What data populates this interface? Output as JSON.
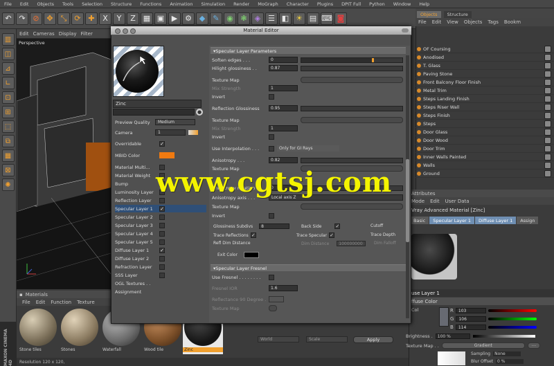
{
  "menubar": {
    "items": [
      "File",
      "Edit",
      "Objects",
      "Tools",
      "Selection",
      "Structure",
      "Functions",
      "Animation",
      "Simulation",
      "Render",
      "MoGraph",
      "Character",
      "Plugins",
      "DPIT Full",
      "Python",
      "Window",
      "Help"
    ]
  },
  "toolbar": {
    "icons": [
      "undo-icon",
      "redo-icon",
      "live-select-icon",
      "move-icon",
      "scale-icon",
      "rotate-icon",
      "recent-icon",
      "x-axis-icon",
      "y-axis-icon",
      "z-axis-icon",
      "world-coordinate-icon",
      "render-region-icon",
      "render-view-icon",
      "render-settings-icon",
      "cube-icon",
      "pen-icon",
      "subdivision-icon",
      "cloner-icon",
      "deformer-icon",
      "scene-icon",
      "camera-icon",
      "light-icon",
      "display-icon",
      "python-icon",
      "layout-icon"
    ]
  },
  "viewport": {
    "menu": [
      "Edit",
      "Cameras",
      "Display",
      "Filter"
    ],
    "label": "Perspective"
  },
  "material_editor": {
    "title": "Material Editor",
    "material_name": "Zinc",
    "channels": [
      {
        "label": "Preview Quality",
        "value": "Medium"
      },
      {
        "label": "Camera",
        "value": "1"
      },
      {
        "label": "Overridable",
        "checked": "✓"
      },
      {
        "label": "MBID Color"
      },
      {
        "label": "Material Multi...",
        "checked": ""
      },
      {
        "label": "Material Weight",
        "checked": ""
      },
      {
        "label": "Bump",
        "checked": ""
      },
      {
        "label": "Luminosity Layer",
        "checked": ""
      },
      {
        "label": "Reflection Layer",
        "checked": ""
      },
      {
        "label": "Specular Layer 1",
        "checked": "✓"
      },
      {
        "label": "Specular Layer 2",
        "checked": ""
      },
      {
        "label": "Specular Layer 3",
        "checked": ""
      },
      {
        "label": "Specular Layer 4",
        "checked": ""
      },
      {
        "label": "Specular Layer 5",
        "checked": ""
      },
      {
        "label": "Diffuse Layer 1",
        "checked": "✓"
      },
      {
        "label": "Diffuse Layer 2",
        "checked": ""
      },
      {
        "label": "Refraction Layer",
        "checked": ""
      },
      {
        "label": "SSS Layer",
        "checked": ""
      },
      {
        "label": "OGL Textures . ."
      },
      {
        "label": "Assignment"
      }
    ],
    "section_params": "Specular Layer Parameters",
    "params": [
      {
        "label": "Soften edges . . .",
        "value": "0"
      },
      {
        "label": "Hilight glossiness . .",
        "value": "0.87"
      },
      {
        "label": "Texture Map"
      },
      {
        "label": "Mix Strength",
        "value": "1"
      },
      {
        "label": "Invert"
      },
      {
        "label": "Reflection Glossiness",
        "value": "0.95"
      },
      {
        "label": "Texture Map"
      },
      {
        "label": "Mix Strength",
        "value": "1"
      },
      {
        "label": "Invert"
      },
      {
        "label": "Use Interpolation . . .",
        "value": "Only for GI Rays"
      },
      {
        "label": "Anisotropy . . .",
        "value": "0.82"
      },
      {
        "label": "Texture Map"
      },
      {
        "label": "Anisotropy rotation",
        "value": "0"
      },
      {
        "label": "Anisotropy axis . . .",
        "value": "Local axis Z"
      },
      {
        "label": "Texture Map"
      },
      {
        "label": "Invert"
      }
    ],
    "options": {
      "glossiness_subdivs": "Glossiness Subdivs",
      "glossiness_subdivs_value": "8",
      "back_side": "Back Side",
      "cutoff": "Cutoff",
      "trace_reflections": "Trace Reflections",
      "trace_specular": "Trace Specular",
      "trace_depth": "Trace Depth",
      "refl_dim_distance": "Refl Dim Distance",
      "dim_distance": "Dim Distance",
      "dim_distance_value": "100000000",
      "dim_falloff": "Dim Falloff",
      "exit_color": "Exit Color"
    },
    "section_fresnel": "Specular Layer Fresnel",
    "fresnel": [
      {
        "label": "Use Fresnel . . . . . . . ."
      },
      {
        "label": "Fresnel IOR",
        "value": "1.6"
      },
      {
        "label": "Reflectance 90 Degree ."
      },
      {
        "label": "Texture Map"
      }
    ],
    "bottom": {
      "world": "World",
      "scale": "Scale",
      "apply": "Apply"
    }
  },
  "watermark": "www.cgtsj.com",
  "materials": {
    "title": "Materials",
    "menu": [
      "File",
      "Edit",
      "Function",
      "Texture"
    ],
    "items": [
      {
        "name": "Stone tiles"
      },
      {
        "name": "Stones"
      },
      {
        "name": "Waterfall"
      },
      {
        "name": "Wood tile"
      },
      {
        "name": "Zinc"
      }
    ],
    "resolution": "Resolution 120 x 120,"
  },
  "objects": {
    "tabs": [
      "Objects",
      "Structure"
    ],
    "menu": [
      "File",
      "Edit",
      "View",
      "Objects",
      "Tags",
      "Bookm"
    ],
    "items": [
      "OF Coursing",
      "Anodised",
      "T. Glass",
      "Paving Stone",
      "Front Balcony Floor Finish",
      "Metal Trim",
      "Steps Landing Finish",
      "Steps Riser Wall",
      "Steps Finish",
      "Steps",
      "Door Glass",
      "Door Wood",
      "Door Trim",
      "Inner Walls Painted",
      "Walls",
      "Ground"
    ]
  },
  "attributes": {
    "title": "Attributes",
    "menu": [
      "Mode",
      "Edit",
      "User Data"
    ],
    "subtitle": "Vray Advanced Material [Zinc]",
    "tabs": [
      "Basic",
      "Specular Layer 1",
      "Diffuse Layer 1",
      "Assign"
    ],
    "layer": "use Layer 1",
    "color_label": "ffuse Color",
    "colors_label": "Col",
    "r": "103",
    "g": "106",
    "b": "114",
    "brightness_label": "Brightness .",
    "brightness": "100 %",
    "texture_map": "Texture Map . .",
    "gradient": "Gradient",
    "sampling": "Sampling",
    "sampling_value": "None",
    "blur_offset": "Blur Offset",
    "blur_value": "0 %"
  },
  "maxon": "MAXON CINEMA 4D"
}
